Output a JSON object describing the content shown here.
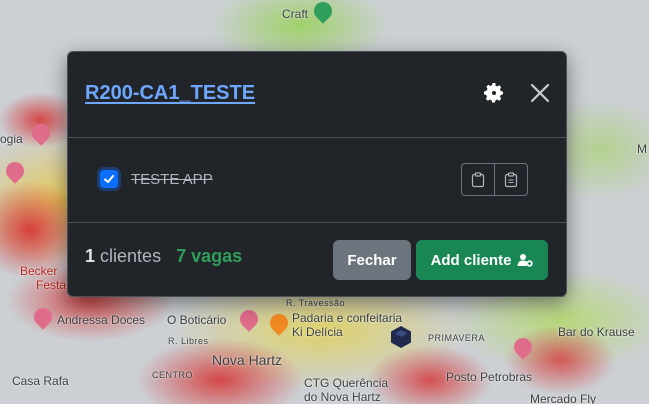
{
  "map": {
    "labels": {
      "craft": "Craft",
      "ogia": "ogia",
      "becker": "Becker",
      "festa": "Festa",
      "andressa": "Andressa Doces",
      "boticario": "O Boticário",
      "padaria": "Padaria e confeitaria",
      "kidelicia": "Ki Delícia",
      "travessao": "R. Travessão",
      "rlibres": "R. Libres",
      "novahartz": "Nova Hartz",
      "centro": "CENTRO",
      "primavera": "PRIMAVERA",
      "casarafa": "Casa Rafa",
      "ctg1": "CTG Querência",
      "ctg2": "do Nova Hartz",
      "postopetrobras": "Posto Petrobras",
      "mercadofly": "Mercado Fly",
      "bardokrause": "Bar do Krause",
      "m": "M"
    }
  },
  "modal": {
    "title": "R200-CA1_TESTE",
    "item_label": "TESTE APP",
    "item_checked": true,
    "clients_count": "1",
    "clients_label": "clientes",
    "vagas": "7 vagas",
    "close_button": "Fechar",
    "add_button": "Add cliente"
  },
  "colors": {
    "modal_bg": "#212529",
    "title_link": "#6ea8fe",
    "vagas": "#2f9e5b",
    "close_button_bg": "#6c757d",
    "add_button_bg": "#198754",
    "checkbox": "#0d6efd"
  },
  "icons": {
    "settings": "gear-icon",
    "close": "close-icon",
    "copy": "clipboard-icon",
    "paste": "clipboard-list-icon",
    "add_user": "user-plus-icon",
    "marker": "cube-marker-icon"
  }
}
